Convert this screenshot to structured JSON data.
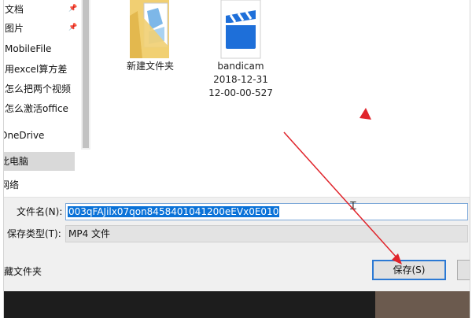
{
  "sidebar": {
    "items": [
      {
        "label": "文档",
        "pinned": true
      },
      {
        "label": "图片",
        "pinned": true
      },
      {
        "label": "MobileFile",
        "pinned": false
      },
      {
        "label": "用excel算方差",
        "pinned": false
      },
      {
        "label": "怎么把两个视频",
        "pinned": false
      },
      {
        "label": "怎么激活office",
        "pinned": false
      },
      {
        "label": "OneDrive",
        "pinned": false
      },
      {
        "label": "此电脑",
        "pinned": false
      },
      {
        "label": "网络",
        "pinned": false
      }
    ]
  },
  "files": [
    {
      "name_lines": [
        "新建文件夹"
      ],
      "icon": "folder-icon"
    },
    {
      "name_lines": [
        "bandicam",
        "2018-12-31",
        "12-00-00-527"
      ],
      "icon": "video-file-icon"
    }
  ],
  "form": {
    "filename_label": "文件名(N):",
    "filename_value": "003qFAJilx07qon8458401041200eEVx0E010",
    "filetype_label": "保存类型(T):",
    "filetype_value": "MP4 文件",
    "hide_folders_label": "隐藏文件夹",
    "save_label": "保存(S)"
  },
  "colors": {
    "selection": "#0a72d8",
    "annotation": "#e0242b",
    "folder": "#e9c46a",
    "bandicam_blue": "#1e6fd9"
  }
}
